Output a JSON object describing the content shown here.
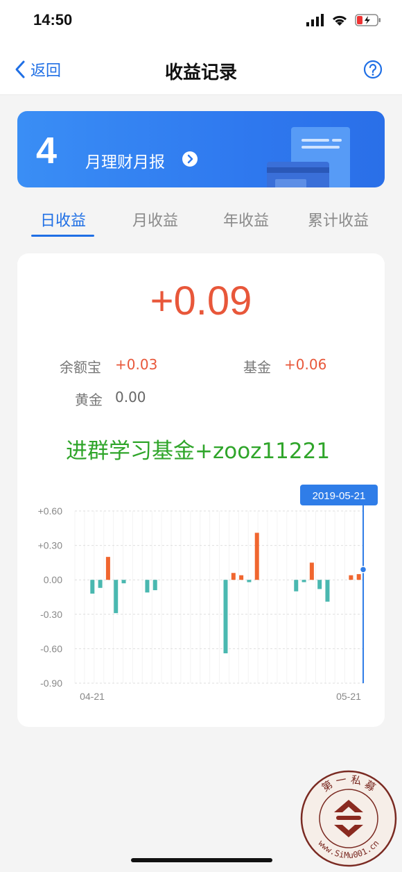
{
  "status": {
    "time": "14:50"
  },
  "nav": {
    "back_label": "返回",
    "title": "收益记录"
  },
  "banner": {
    "month": "4",
    "text": "月理财月报"
  },
  "tabs": [
    "日收益",
    "月收益",
    "年收益",
    "累计收益"
  ],
  "summary": {
    "total": "+0.09",
    "items": [
      {
        "label": "余额宝",
        "value": "+0.03"
      },
      {
        "label": "基金",
        "value": "+0.06"
      },
      {
        "label": "黄金",
        "value": "0.00"
      }
    ]
  },
  "overlay_text": "进群学习基金+zooz11221",
  "chart_data": {
    "type": "bar",
    "ylim": [
      -0.9,
      0.6
    ],
    "y_ticks": [
      "+0.60",
      "+0.30",
      "0.00",
      "-0.30",
      "-0.60",
      "-0.90"
    ],
    "x_labels": [
      "04-21",
      "05-21"
    ],
    "selected_date": "2019-05-21",
    "series": [
      {
        "values": [
          0,
          -0.12,
          -0.07,
          0.2,
          -0.29,
          -0.03,
          0,
          0,
          -0.11,
          -0.09,
          0,
          0,
          0,
          0,
          0,
          0,
          0,
          0,
          -0.64,
          0.06,
          0.04,
          -0.02,
          0.41,
          0,
          0,
          0,
          0,
          -0.1,
          -0.02,
          0.15,
          -0.08,
          -0.19,
          0,
          0,
          0.04,
          0.05
        ]
      }
    ],
    "colors": {
      "positive": "#f0662f",
      "negative": "#4ab8b0",
      "highlight": "#2f7de8"
    }
  },
  "seal": {
    "text_top": "第 一 私 募",
    "text_bottom": "www.SiMu001.cn"
  }
}
